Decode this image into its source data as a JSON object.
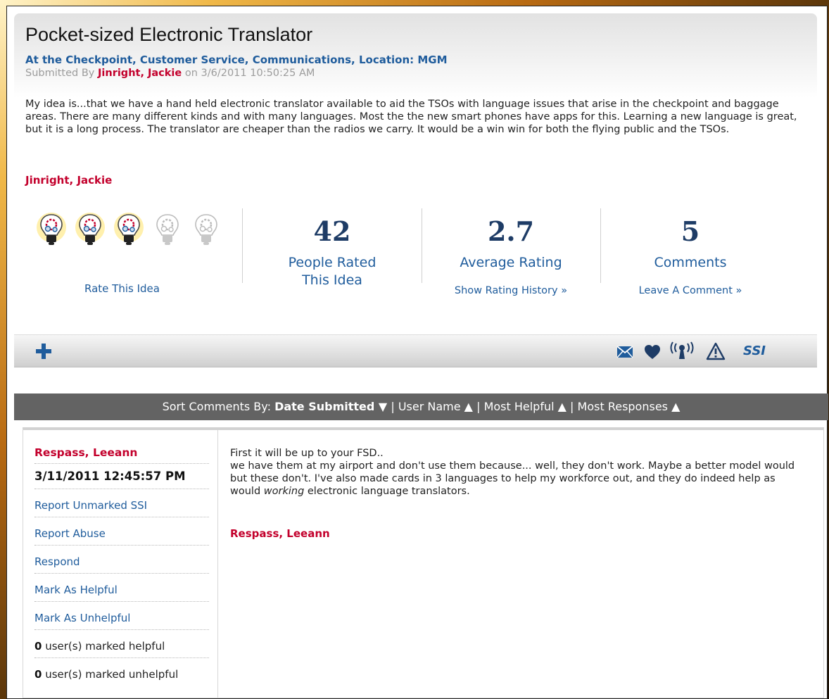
{
  "idea": {
    "title": "Pocket-sized Electronic Translator",
    "categories": "At the Checkpoint, Customer Service, Communications, Location: MGM",
    "submitted_prefix": "Submitted By",
    "submitted_author": "Jinright, Jackie",
    "submitted_date": "on 3/6/2011 10:50:25 AM",
    "description": "My idea is...that we have a hand held electronic translator available to aid the TSOs with language issues that arise in the checkpoint and baggage areas.  There are many different kinds and with many languages.  Most the the new smart phones have apps for this.  Learning a new language is great, but it is a long process.  The translator are cheaper than the radios we carry. It would be a win win for both the flying public and the TSOs.",
    "signature": "Jinright, Jackie"
  },
  "rating": {
    "bulbs_lit": 3,
    "bulbs_total": 5,
    "rate_label": "Rate This Idea",
    "people_count": "42",
    "people_label_line1": "People Rated",
    "people_label_line2": "This Idea",
    "average": "2.7",
    "average_label": "Average Rating",
    "history_link": "Show Rating History »",
    "comments_count": "5",
    "comments_label": "Comments",
    "comment_link": "Leave A Comment »"
  },
  "toolbar": {
    "icons": [
      "plus-icon",
      "mail-icon",
      "heart-icon",
      "broadcast-icon",
      "warning-icon",
      "ssi-label"
    ],
    "ssi_label": "SSI",
    "accent": "#1f5c9c"
  },
  "sort": {
    "prefix": "Sort Comments By:",
    "options": [
      {
        "label": "Date Submitted",
        "arrow": "▼",
        "active": true
      },
      {
        "label": "User Name",
        "arrow": "▲",
        "active": false
      },
      {
        "label": "Most Helpful",
        "arrow": "▲",
        "active": false
      },
      {
        "label": "Most Responses",
        "arrow": "▲",
        "active": false
      }
    ]
  },
  "comment": {
    "author": "Respass, Leeann",
    "date": "3/11/2011 12:45:57 PM",
    "actions": [
      "Report Unmarked SSI",
      "Report Abuse",
      "Respond",
      "Mark As Helpful",
      "Mark As Unhelpful"
    ],
    "helpful_count": "0",
    "helpful_text": "user(s) marked helpful",
    "unhelpful_count": "0",
    "unhelpful_text": "user(s) marked unhelpful",
    "body_line1": "First it will be up to your FSD..",
    "body_before_italic": "we have them at my airport and don't use them because... well, they don't work. Maybe a better model would but these don't. I've also made cards in 3 languages to help my workforce out, and they do indeed help as would ",
    "body_italic": "working",
    "body_after_italic": " electronic language translators.",
    "signature": "Respass, Leeann"
  },
  "colors": {
    "link_blue": "#1f5c9c",
    "author_red": "#c3002c",
    "stat_navy": "#1e3c66",
    "sort_bar": "#636363"
  }
}
